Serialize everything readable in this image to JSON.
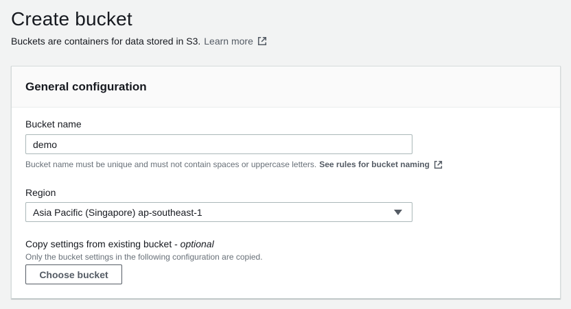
{
  "header": {
    "title": "Create bucket",
    "description": "Buckets are containers for data stored in S3.",
    "learn_more": "Learn more"
  },
  "panel": {
    "title": "General configuration",
    "bucket_name": {
      "label": "Bucket name",
      "value": "demo",
      "hint": "Bucket name must be unique and must not contain spaces or uppercase letters.",
      "hint_link": "See rules for bucket naming"
    },
    "region": {
      "label": "Region",
      "selected": "Asia Pacific (Singapore) ap-southeast-1"
    },
    "copy_settings": {
      "label": "Copy settings from existing bucket -",
      "label_optional": "optional",
      "hint": "Only the bucket settings in the following configuration are copied.",
      "button": "Choose bucket"
    }
  },
  "icons": {
    "external_link": "external-link-icon",
    "dropdown": "caret-down-icon"
  },
  "colors": {
    "page_bg": "#f2f3f3",
    "panel_header_bg": "#fafafa",
    "text": "#16191f",
    "secondary_text": "#687078",
    "link": "#545b64"
  }
}
